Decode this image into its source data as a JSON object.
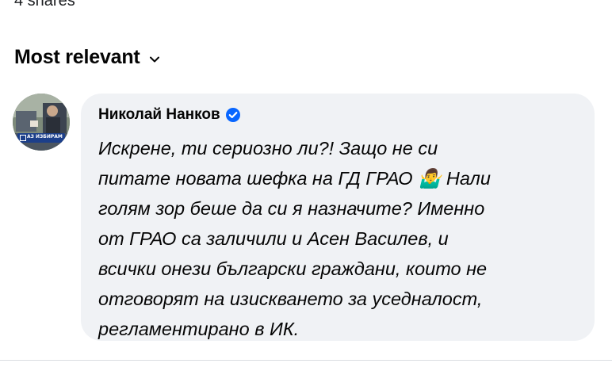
{
  "post": {
    "shares_text": "4 shares"
  },
  "comments_sort": {
    "label": "Most relevant",
    "chevron_icon": "chevron-down-icon"
  },
  "comment": {
    "author": "Николай Нанков",
    "verified_icon": "verified-badge-icon",
    "text": "Искрене, ти сериозно ли?! Защо не си\nпитате новата шефка на ГД ГРАО 🤷‍♂️ Нали\nголям зор беше да си я назначите? Именно\nот ГРАО са заличили и Асен Василев, и\nвсички онези български граждани, които не\nотговорят на изискването за уседналост,\nрегламентирано в ИК.",
    "avatar_badge_text": "АЗ ИЗБИРАМ"
  },
  "colors": {
    "bubble_bg": "#f0f2f5",
    "verified_blue": "#0866ff",
    "text": "#050505"
  }
}
